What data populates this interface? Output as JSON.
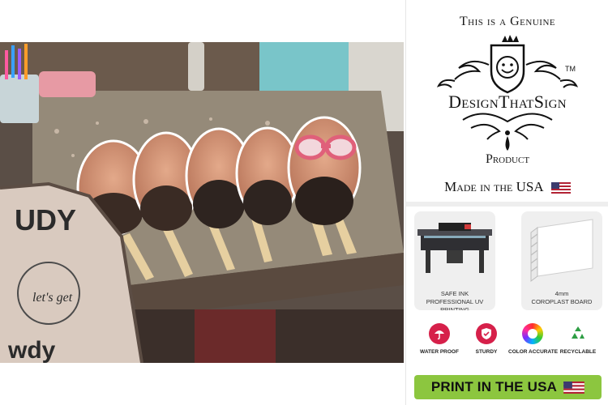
{
  "panel": {
    "genuine_text": "This is a Genuine",
    "brand_name": "DesignThatSign",
    "trademark": "TM",
    "product_text": "Product",
    "made_in_text": "Made in the USA",
    "cards": [
      {
        "caption_line1": "SAFE INK",
        "caption_line2": "PROFESSIONAL UV PRINTING",
        "illustration": "uv-printer-icon"
      },
      {
        "caption_line1": "4mm",
        "caption_line2": "COROPLAST BOARD",
        "illustration": "coroplast-board-icon"
      }
    ],
    "features": [
      {
        "label": "WATER PROOF",
        "icon": "umbrella-icon",
        "color": "#d6204a"
      },
      {
        "label": "STURDY",
        "icon": "shield-check-icon",
        "color": "#d6204a"
      },
      {
        "label": "COLOR ACCURATE",
        "icon": "color-wheel-icon",
        "color": "#e0e0e0"
      },
      {
        "label": "RECYCLABLE",
        "icon": "recycle-icon",
        "color": "#2e9e44"
      }
    ],
    "print_button_label": "PRINT IN THE USA",
    "accent_green": "#8cc63f"
  },
  "photo": {
    "description_icon": "product-photo-big-head-fans",
    "shirt_text_top": "UDY",
    "shirt_text_bottom": "wdy",
    "shirt_script": "let's get"
  }
}
